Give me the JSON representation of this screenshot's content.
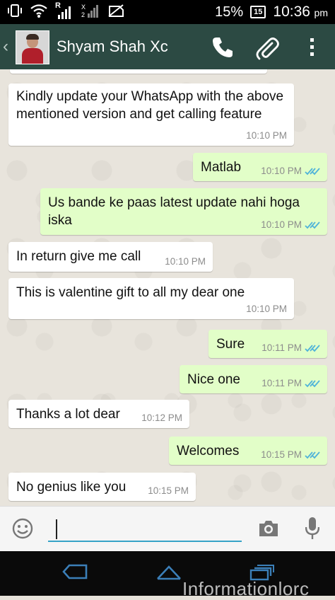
{
  "status_bar": {
    "battery_percent": "15%",
    "battery_level": "15",
    "time": "10:36",
    "ampm": "pm",
    "network_label": "R"
  },
  "header": {
    "contact_name": "Shyam Shah Xc",
    "icons": [
      "back-chevron-icon",
      "call-icon",
      "attach-icon",
      "overflow-menu-icon"
    ],
    "color": "#2c4a43"
  },
  "messages": [
    {
      "direction": "in",
      "text": "Kindly update your WhatsApp with the above mentioned version and get calling feature",
      "time": "10:10 PM"
    },
    {
      "direction": "out",
      "text": "Matlab",
      "time": "10:10 PM",
      "status": "read"
    },
    {
      "direction": "out",
      "text": "Us bande ke paas latest update nahi hoga iska",
      "time": "10:10 PM",
      "status": "read"
    },
    {
      "direction": "in",
      "text": "In return give me call",
      "time": "10:10 PM"
    },
    {
      "direction": "in",
      "text": "This is valentine gift to all my dear one",
      "time": "10:10 PM"
    },
    {
      "direction": "out",
      "text": "Sure",
      "time": "10:11 PM",
      "status": "read"
    },
    {
      "direction": "out",
      "text": "Nice one",
      "time": "10:11 PM",
      "status": "read"
    },
    {
      "direction": "in",
      "text": "Thanks a lot dear",
      "time": "10:12 PM"
    },
    {
      "direction": "out",
      "text": "Welcomes",
      "time": "10:15 PM",
      "status": "read"
    },
    {
      "direction": "in",
      "text": "No genius like you",
      "time": "10:15 PM"
    }
  ],
  "composer": {
    "value": "",
    "placeholder": "",
    "icons": [
      "emoji-icon",
      "camera-icon",
      "mic-icon"
    ]
  },
  "nav_bar": {
    "icons": [
      "nav-back-icon",
      "nav-home-icon",
      "nav-recent-apps-icon"
    ],
    "watermark": "Informationlorc"
  },
  "colors": {
    "incoming_bubble": "#ffffff",
    "outgoing_bubble": "#e2fec8",
    "read_ticks": "#4fb3d9",
    "input_underline": "#36a3c7"
  }
}
